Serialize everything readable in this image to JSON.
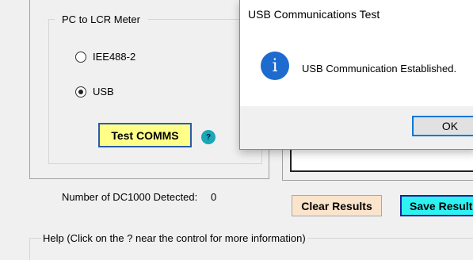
{
  "connection_group": {
    "title": "PC to LCR Meter",
    "options": [
      {
        "label": "IEE488-2",
        "selected": false
      },
      {
        "label": "USB",
        "selected": true
      }
    ],
    "test_button_label": "Test COMMS",
    "help_icon_glyph": "?"
  },
  "status": {
    "detected_label": "Number of DC1000 Detected:",
    "detected_value": "0"
  },
  "results": {
    "clear_label": "Clear Results",
    "save_label": "Save Results"
  },
  "help": {
    "label": "Help (Click on the ? near the control for more information)"
  },
  "dialog": {
    "title": "USB Communications Test",
    "icon": "info-icon",
    "icon_glyph": "i",
    "message": "USB Communication Established.",
    "ok_label": "OK"
  },
  "colors": {
    "test_button_bg": "#ffff88",
    "clear_button_bg": "#fbe4cc",
    "save_button_bg": "#2ef2f2",
    "info_icon": "#1e6bcf",
    "help_icon": "#1aa7b6"
  }
}
